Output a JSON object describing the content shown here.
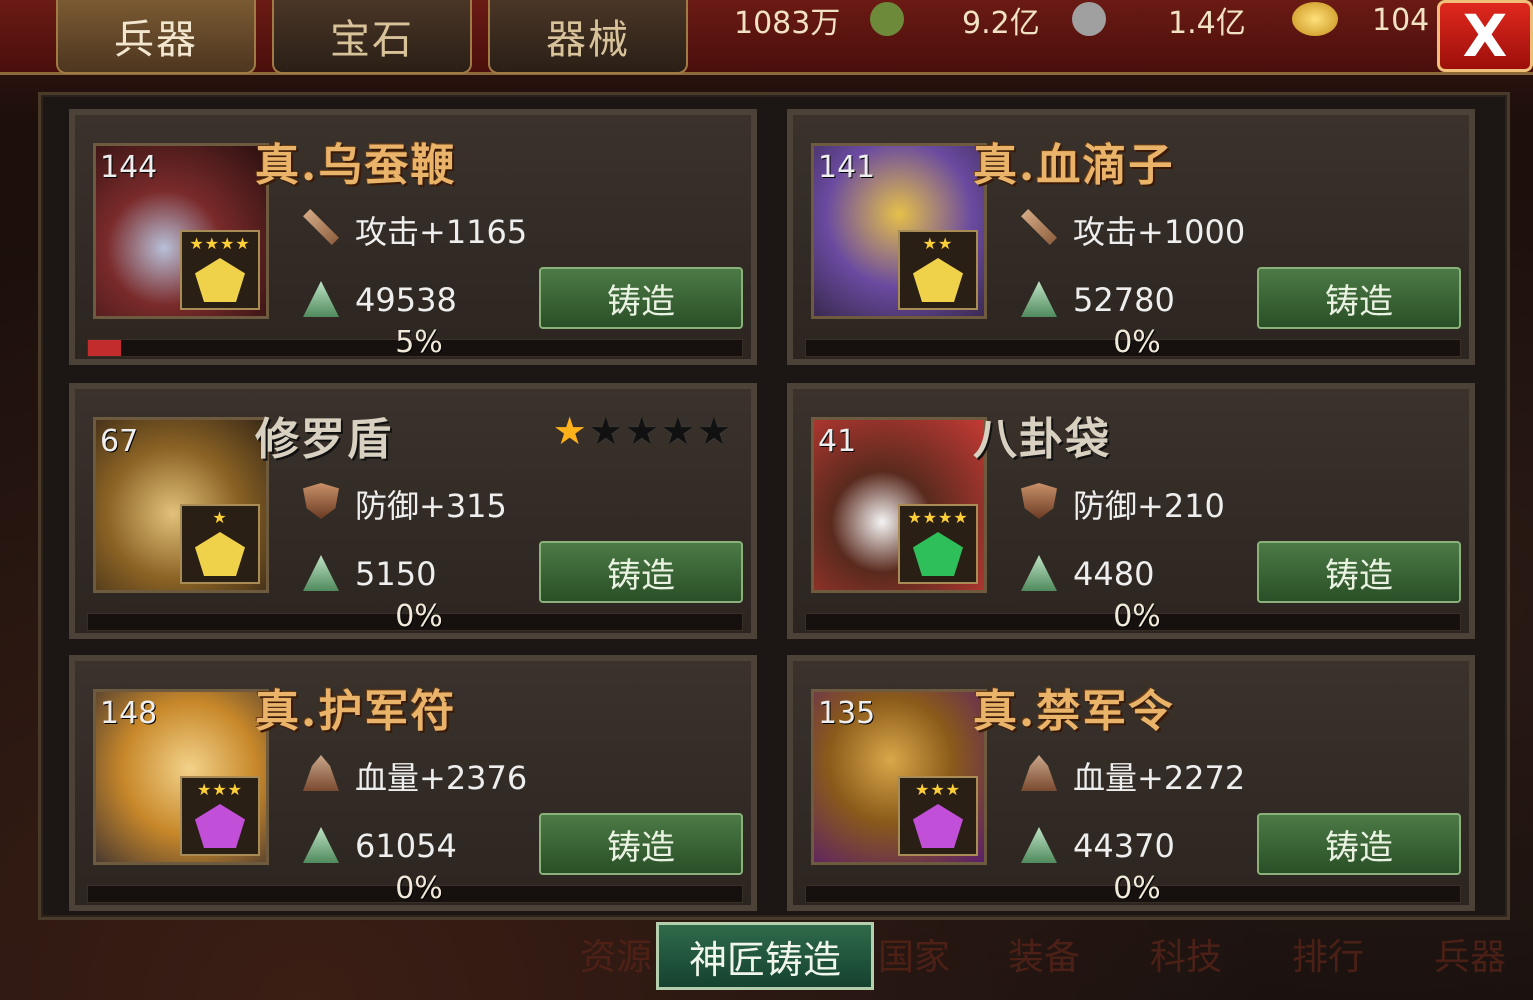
{
  "tabs": [
    {
      "label": "兵器",
      "active": true
    },
    {
      "label": "宝石",
      "active": false
    },
    {
      "label": "器械",
      "active": false
    }
  ],
  "resources": [
    {
      "icon": "grain-icon",
      "value": "1083万"
    },
    {
      "icon": "stone-icon",
      "value": "9.2亿"
    },
    {
      "icon": "coin-icon",
      "value": "1.4亿"
    },
    {
      "icon": "gold-ingot-icon",
      "value": "104"
    }
  ],
  "close_label": "X",
  "forge_label": "铸造",
  "cards": [
    {
      "level": "144",
      "name": "真.乌蚕鞭",
      "gem_stars": "★★★★",
      "gem_color": "#f0d24a",
      "stat_icon": "sword-icon",
      "stat": "攻击+1165",
      "cost": "49538",
      "progress_pct": 5,
      "progress_label": "5%"
    },
    {
      "level": "141",
      "name": "真.血滴子",
      "gem_stars": "★★",
      "gem_color": "#f0d24a",
      "stat_icon": "sword-icon",
      "stat": "攻击+1000",
      "cost": "52780",
      "progress_pct": 0,
      "progress_label": "0%"
    },
    {
      "level": "67",
      "name": "修罗盾",
      "gem_stars": "★",
      "gem_color": "#f0d24a",
      "stat_icon": "shield-icon",
      "stat": "防御+315",
      "cost": "5150",
      "progress_pct": 0,
      "progress_label": "0%",
      "rating": 1,
      "rating_max": 5
    },
    {
      "level": "41",
      "name": "八卦袋",
      "gem_stars": "★★★★",
      "gem_color": "#2fbf5a",
      "stat_icon": "shield-icon",
      "stat": "防御+210",
      "cost": "4480",
      "progress_pct": 0,
      "progress_label": "0%"
    },
    {
      "level": "148",
      "name": "真.护军符",
      "gem_stars": "★★★",
      "gem_color": "#c24fd8",
      "stat_icon": "health-icon",
      "stat": "血量+2376",
      "cost": "61054",
      "progress_pct": 0,
      "progress_label": "0%"
    },
    {
      "level": "135",
      "name": "真.禁军令",
      "gem_stars": "★★★",
      "gem_color": "#c24fd8",
      "stat_icon": "health-icon",
      "stat": "血量+2272",
      "cost": "44370",
      "progress_pct": 0,
      "progress_label": "0%"
    }
  ],
  "master_forge_label": "神匠铸造",
  "bottom_nav": [
    "资源",
    "国家",
    "装备",
    "科技",
    "排行",
    "兵器"
  ],
  "colors": {
    "title_gold": "#e9b36a",
    "forge_green": "#2a4f27",
    "progress_red": "#c22c2c",
    "close_red": "#d01e16"
  }
}
